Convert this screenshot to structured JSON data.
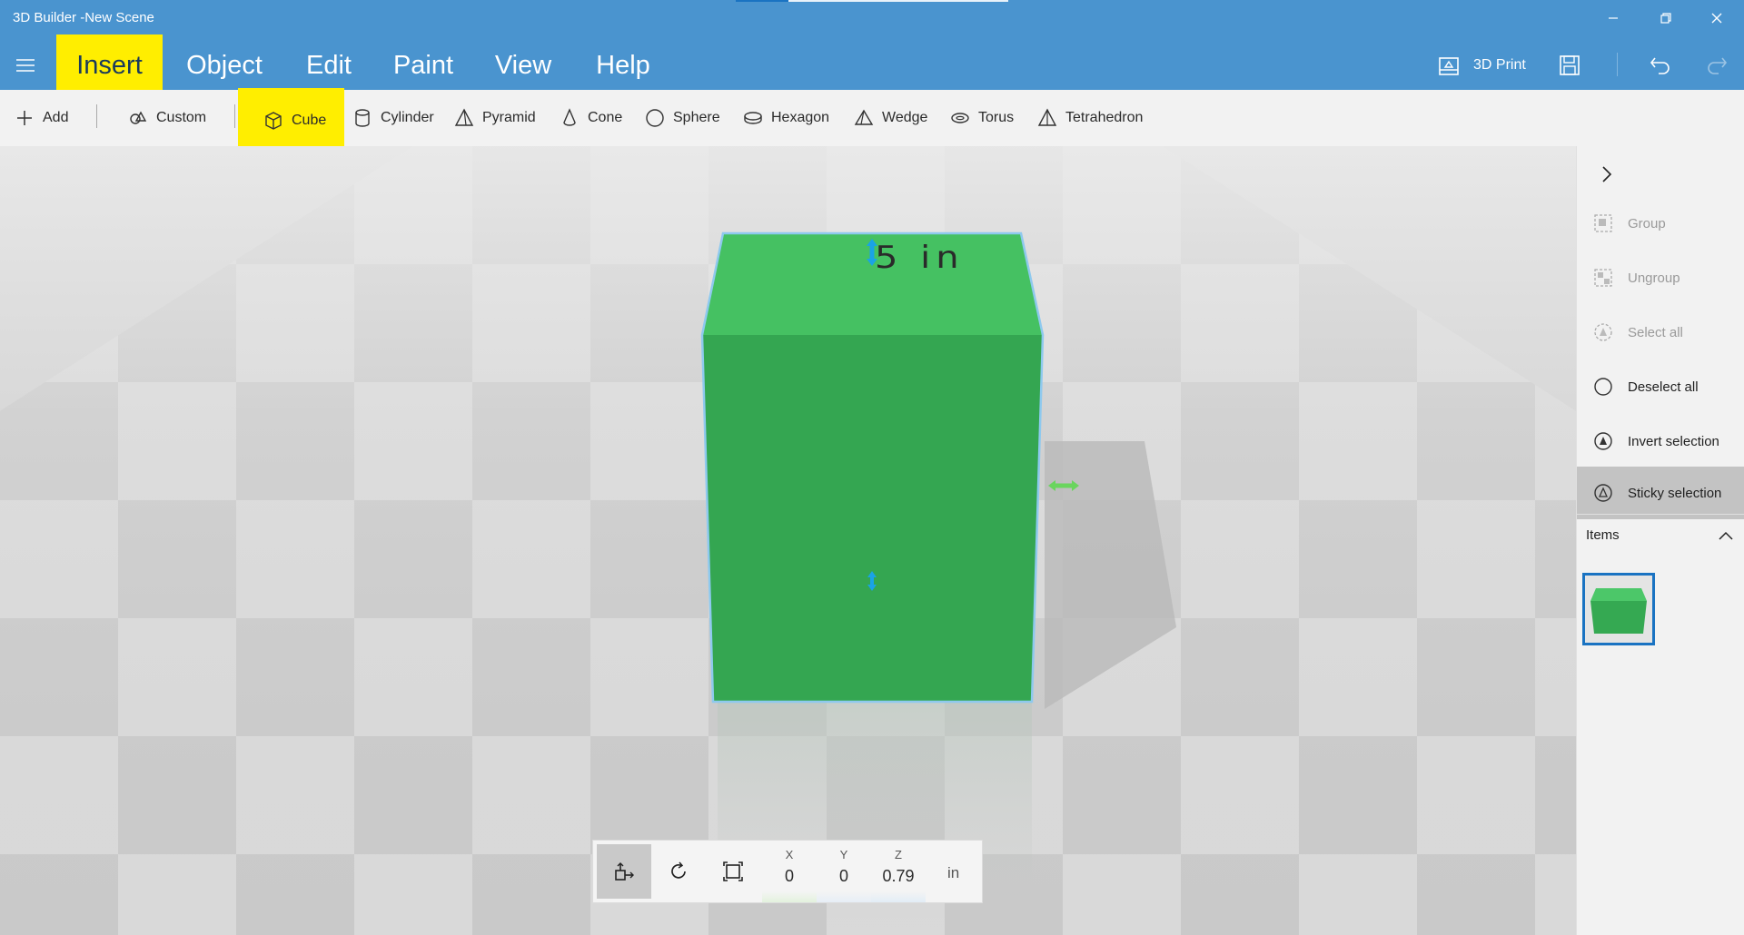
{
  "window": {
    "title": "3D Builder -New Scene",
    "controls": [
      "minimize-icon",
      "restore-icon",
      "close-icon"
    ]
  },
  "menu": {
    "tabs": [
      {
        "label": "Insert",
        "active": true
      },
      {
        "label": "Object"
      },
      {
        "label": "Edit"
      },
      {
        "label": "Paint"
      },
      {
        "label": "View"
      },
      {
        "label": "Help"
      }
    ],
    "right": {
      "print_label": "3D Print"
    }
  },
  "ribbon": {
    "items": [
      {
        "label": "Add",
        "icon": "plus-icon"
      },
      {
        "label": "Custom",
        "icon": "shapes-icon"
      },
      {
        "label": "Cube",
        "icon": "cube-icon",
        "highlighted": true
      },
      {
        "label": "Cylinder",
        "icon": "cylinder-icon"
      },
      {
        "label": "Pyramid",
        "icon": "pyramid-icon"
      },
      {
        "label": "Cone",
        "icon": "cone-icon"
      },
      {
        "label": "Sphere",
        "icon": "sphere-icon"
      },
      {
        "label": "Hexagon",
        "icon": "hexagon-icon"
      },
      {
        "label": "Wedge",
        "icon": "wedge-icon"
      },
      {
        "label": "Torus",
        "icon": "torus-icon"
      },
      {
        "label": "Tetrahedron",
        "icon": "tetrahedron-icon"
      }
    ]
  },
  "scene": {
    "dimension_label": "5 in",
    "object_color": "#36ad56",
    "accent": "#ffee00"
  },
  "transform": {
    "x_label": "X",
    "x_value": "0",
    "y_label": "Y",
    "y_value": "0",
    "z_label": "Z",
    "z_value": "0.79",
    "unit": "in"
  },
  "panel": {
    "items": [
      {
        "label": "Group",
        "enabled": false
      },
      {
        "label": "Ungroup",
        "enabled": false
      },
      {
        "label": "Select all",
        "enabled": false
      },
      {
        "label": "Deselect all",
        "enabled": true
      },
      {
        "label": "Invert selection",
        "enabled": true
      },
      {
        "label": "Sticky selection",
        "enabled": true,
        "active": true
      }
    ],
    "items_header": "Items"
  },
  "colors": {
    "title_bar": "#4a94cf",
    "highlight": "#ffee00",
    "cube_top": "#45c162",
    "cube_front": "#34a651",
    "selection_border": "#1a73c2"
  }
}
